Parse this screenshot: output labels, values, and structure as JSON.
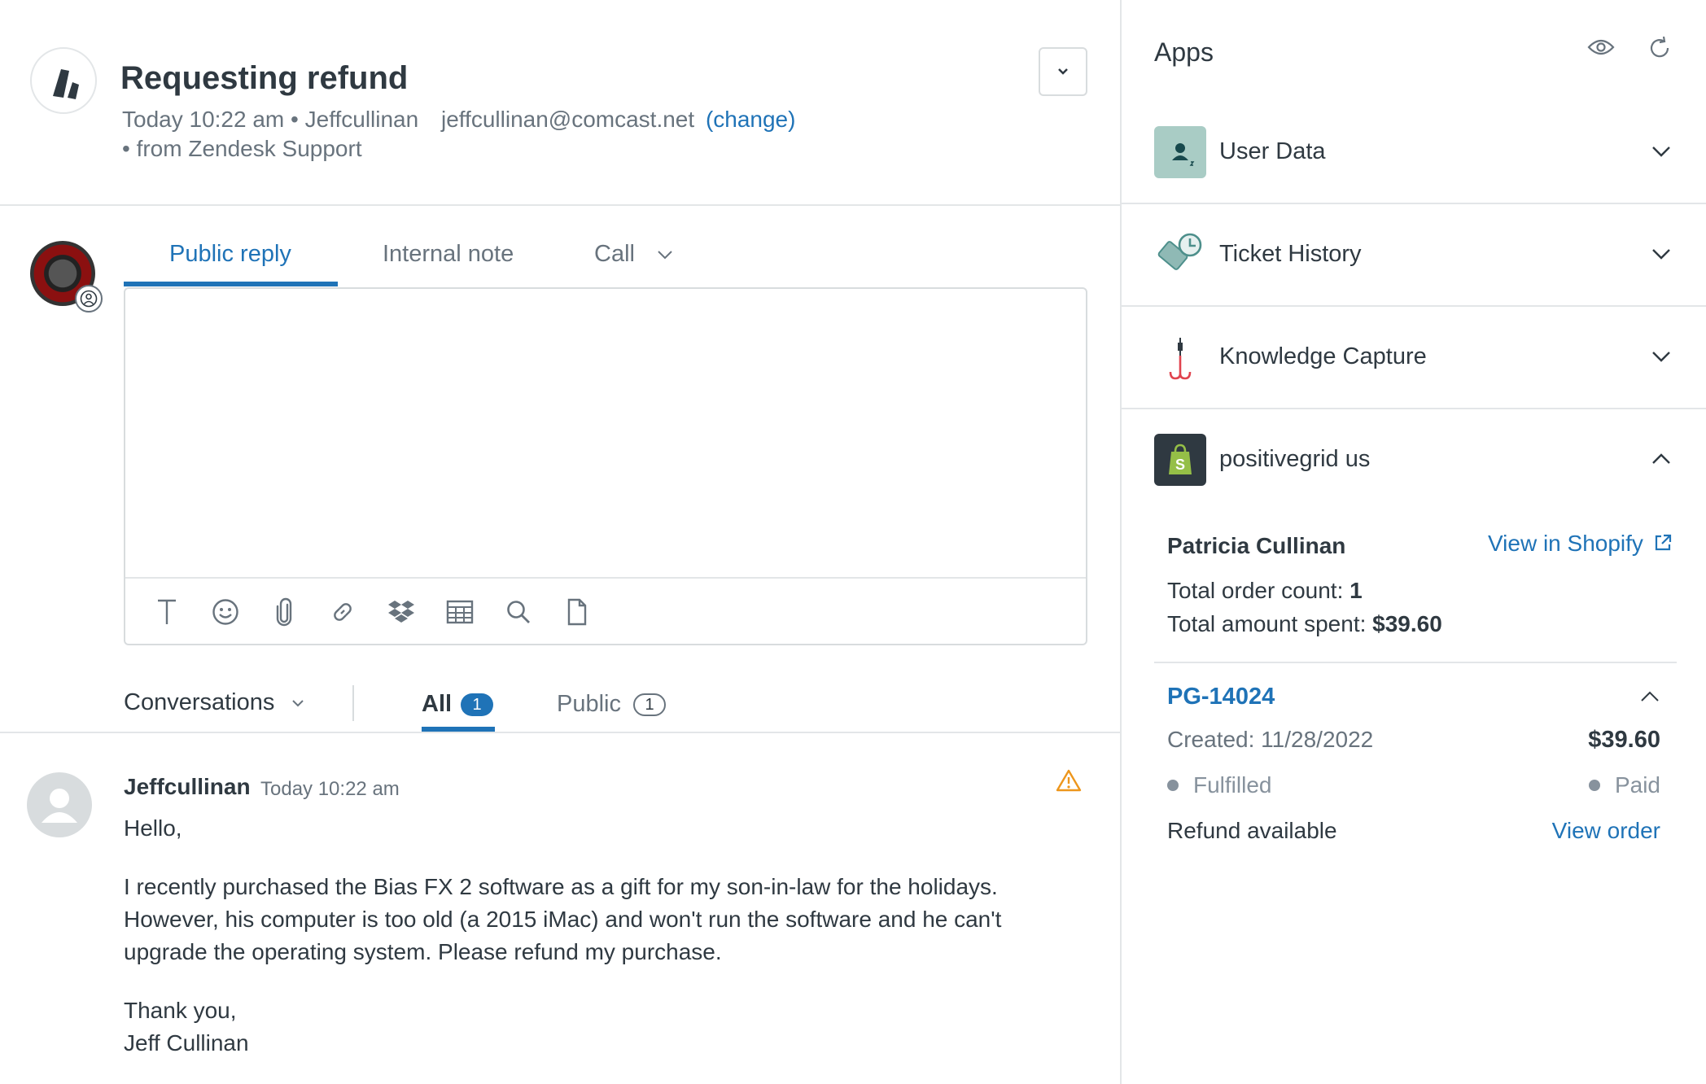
{
  "ticket": {
    "subject": "Requesting refund",
    "timestamp": "Today 10:22 am",
    "requester": "Jeffcullinan",
    "email": "jeffcullinan@comcast.net",
    "change_label": "(change)",
    "source": "• from Zendesk Support"
  },
  "composer": {
    "tabs": [
      "Public reply",
      "Internal note",
      "Call"
    ],
    "toolbar_icons": [
      "text-format-icon",
      "emoji-icon",
      "attachment-icon",
      "link-icon",
      "dropbox-icon",
      "table-icon",
      "search-icon",
      "document-icon"
    ]
  },
  "conversations": {
    "filter_label": "Conversations",
    "all_label": "All",
    "all_count": "1",
    "public_label": "Public",
    "public_count": "1"
  },
  "message": {
    "author": "Jeffcullinan",
    "time": "Today 10:22 am",
    "greeting": "Hello,",
    "body": "I recently purchased the Bias FX 2 software as a gift for my son-in-law for the holidays. However, his computer is too old (a 2015 iMac) and won't run the software and he can't upgrade the operating system. Please refund my purchase.",
    "closing": "Thank you,",
    "signature": "Jeff Cullinan"
  },
  "apps": {
    "title": "Apps",
    "items": [
      {
        "name": "User Data",
        "icon": "user-data-icon"
      },
      {
        "name": "Ticket History",
        "icon": "ticket-history-icon"
      },
      {
        "name": "Knowledge Capture",
        "icon": "knowledge-capture-icon"
      },
      {
        "name": "positivegrid us",
        "icon": "shopify-icon"
      }
    ]
  },
  "shopify": {
    "customer_name": "Patricia Cullinan",
    "view_link": "View in Shopify",
    "order_count_label": "Total order count:",
    "order_count": "1",
    "amount_spent_label": "Total amount spent:",
    "amount_spent": "$39.60",
    "order": {
      "id": "PG-14024",
      "created": "Created: 11/28/2022",
      "amount": "$39.60",
      "fulfillment_status": "Fulfilled",
      "payment_status": "Paid",
      "refund_label": "Refund available",
      "view_order_label": "View order"
    }
  },
  "colors": {
    "accent": "#1f73b7",
    "text": "#2f3941",
    "muted": "#68737d",
    "border": "#d8dcde",
    "warning": "#ed961c"
  }
}
